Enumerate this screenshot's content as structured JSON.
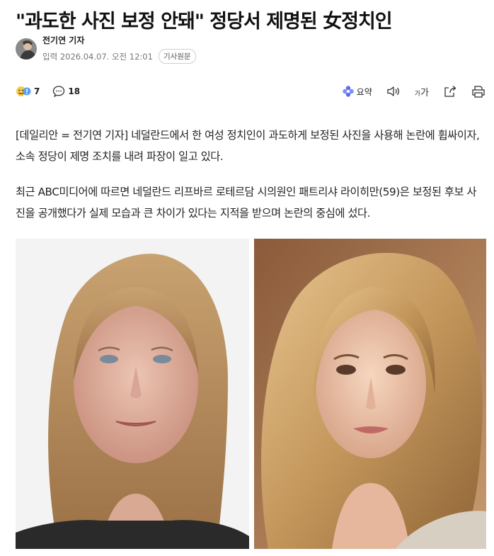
{
  "article": {
    "headline": "\"과도한 사진 보정 안돼\" 정당서 제명된 女정치인",
    "reporter": "전기연 기자",
    "timestamp": "입력 2026.04.07. 오전 12:01",
    "badge": "기사원문"
  },
  "toolbar": {
    "reaction_count": "7",
    "comment_count": "18",
    "summary_label": "요약",
    "font_size_label": "가가",
    "icons": [
      "reaction-emoji-icon",
      "comment-icon",
      "summary-icon",
      "audio-icon",
      "font-size-icon",
      "share-icon",
      "print-icon"
    ]
  },
  "body": {
    "paragraph1": "[데일리안 = 전기연 기자] 네덜란드에서 한 여성 정치인이 과도하게 보정된 사진을 사용해 논란에 휩싸이자, 소속 정당이 제명 조치를 내려 파장이 일고 있다.",
    "paragraph2": "최근 ABC미디어에 따르면 네덜란드 리프바르 로테르담 시의원인 패트리샤 라이히만(59)은 보정된 후보 사진을 공개했다가 실제 모습과 큰 차이가 있다는 지적을 받으며 논란의 중심에 섰다."
  },
  "images": {
    "left": "actual-photo",
    "right": "retouched-photo"
  },
  "colors": {
    "headline": "#111111",
    "meta": "#777777",
    "summary_icon": "#5b6cf0"
  }
}
